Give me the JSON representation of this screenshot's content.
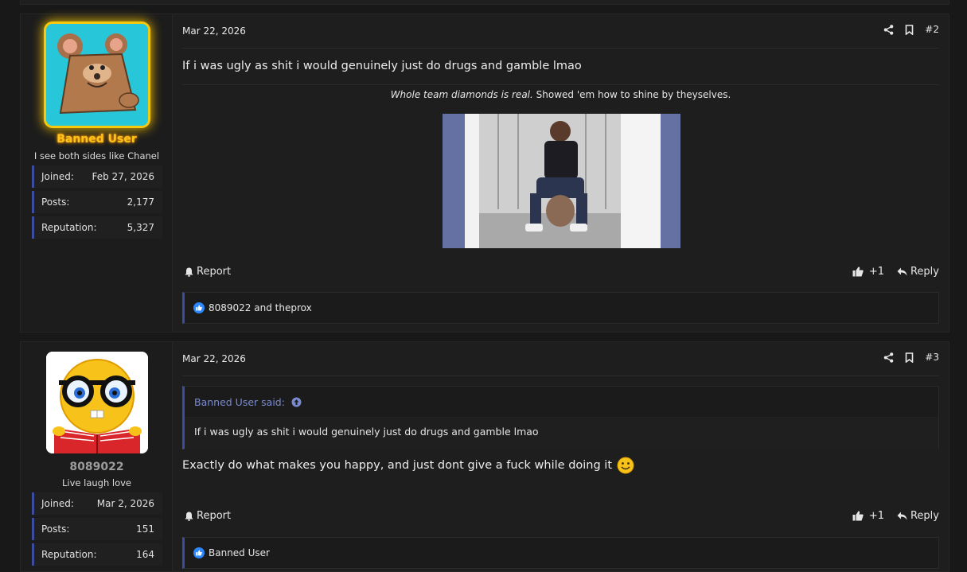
{
  "posts": [
    {
      "user": {
        "name": "Banned User",
        "title": "I see both sides like Chanel",
        "stats": [
          {
            "label": "Joined:",
            "value": "Feb 27, 2026"
          },
          {
            "label": "Posts:",
            "value": "2,177"
          },
          {
            "label": "Reputation:",
            "value": "5,327"
          }
        ]
      },
      "date": "Mar 22, 2026",
      "number": "#2",
      "content": "If i was ugly as shit i would genuinely just do drugs and gamble lmao",
      "signature": {
        "italic": "Whole team diamonds is real.",
        "rest": " Showed 'em how to shine by theyselves."
      },
      "report_label": "Report",
      "like_count": "+1",
      "reply_label": "Reply",
      "reactions": "8089022 and theprox"
    },
    {
      "user": {
        "name": "8089022",
        "title": "Live laugh love",
        "stats": [
          {
            "label": "Joined:",
            "value": "Mar 2, 2026"
          },
          {
            "label": "Posts:",
            "value": "151"
          },
          {
            "label": "Reputation:",
            "value": "164"
          }
        ]
      },
      "date": "Mar 22, 2026",
      "number": "#3",
      "quote": {
        "author": "Banned User said:",
        "text": "If i was ugly as shit i would genuinely just do drugs and gamble lmao"
      },
      "content": "Exactly do what makes you happy, and just dont give a fuck while doing it",
      "report_label": "Report",
      "like_count": "+1",
      "reply_label": "Reply",
      "reactions": "Banned User"
    }
  ],
  "icons": {
    "share": "share-icon",
    "bookmark": "bookmark-icon",
    "bell": "bell-icon",
    "like": "thumbs-up-icon",
    "reply": "reply-icon",
    "smile": "smiley-emoji",
    "quote_jump": "arrow-up-circle-icon"
  },
  "colors": {
    "accent": "#3d4d9e",
    "banned_name": "#ffc21a",
    "quote_author": "#7b8ad0"
  }
}
